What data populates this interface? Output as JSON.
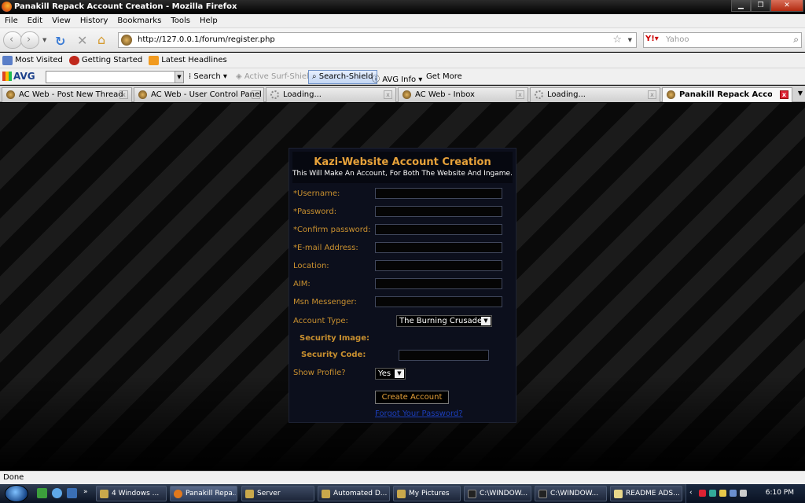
{
  "window": {
    "title": "Panakill Repack Account Creation - Mozilla Firefox"
  },
  "menu": [
    "File",
    "Edit",
    "View",
    "History",
    "Bookmarks",
    "Tools",
    "Help"
  ],
  "nav": {
    "url": "http://127.0.0.1/forum/register.php",
    "search_placeholder": "Yahoo"
  },
  "bookmarks": [
    "Most Visited",
    "Getting Started",
    "Latest Headlines"
  ],
  "avg": {
    "logo": "AVG",
    "search": "Search",
    "surf_shield": "Active Surf-Shield",
    "search_shield": "Search-Shield",
    "info": "AVG Info",
    "more": "Get More"
  },
  "tabs": [
    {
      "label": "AC Web - Post New Thread",
      "state": "normal"
    },
    {
      "label": "AC Web - User Control Panel",
      "state": "normal"
    },
    {
      "label": "Loading...",
      "state": "loading"
    },
    {
      "label": "AC Web - Inbox",
      "state": "normal"
    },
    {
      "label": "Loading...",
      "state": "loading"
    },
    {
      "label": "Panakill Repack Account ...",
      "state": "active"
    }
  ],
  "form": {
    "title": "Kazi-Website Account Creation",
    "subtitle": "This Will Make An Account, For Both The Website And Ingame.",
    "fields": [
      "*Username:",
      "*Password:",
      "*Confirm password:",
      "*E-mail Address:",
      "Location:",
      "AIM:",
      "Msn Messenger:"
    ],
    "account_type_label": "Account Type:",
    "account_type_value": "The Burning Crusade",
    "security_image_label": "Security Image:",
    "security_code_label": "Security Code:",
    "show_profile_label": "Show Profile?",
    "show_profile_value": "Yes",
    "submit": "Create Account",
    "forgot": "Forgot Your Password?"
  },
  "status": "Done",
  "taskbar": {
    "tasks": [
      "4 Windows ...",
      "Panakill Repa...",
      "Server",
      "Automated D...",
      "My Pictures",
      "C:\\WINDOW...",
      "C:\\WINDOW...",
      "README ADS..."
    ],
    "clock": "6:10 PM"
  }
}
